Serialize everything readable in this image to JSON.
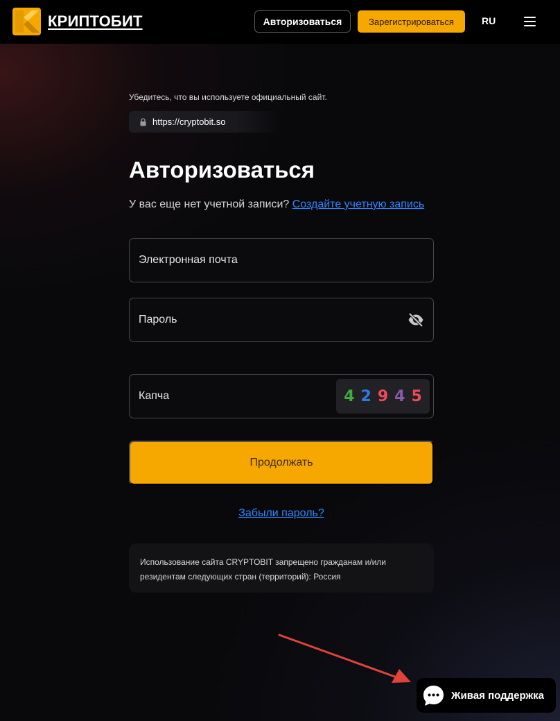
{
  "header": {
    "logo_text": "КРИПТОБИТ",
    "login_label": "Авторизоваться",
    "register_label": "Зарегистрироваться",
    "language": "RU",
    "menu_icon": "hamburger-menu-icon"
  },
  "notice_official": {
    "text": "Убедитесь, что вы используете официальный сайт.",
    "url": "https://cryptobit.so",
    "icon": "lock-icon"
  },
  "form": {
    "title": "Авторизоваться",
    "no_account_text": "У вас еще нет учетной записи?",
    "create_account_link": "Создайте учетную запись",
    "email_placeholder": "Электронная почта",
    "password_placeholder": "Пароль",
    "password_toggle_icon": "eye-off-icon",
    "captcha_placeholder": "Капча",
    "captcha_digits": [
      "4",
      "2",
      "9",
      "4",
      "5"
    ],
    "captcha_colors": [
      "#3fae3a",
      "#2a7de1",
      "#ef4a5a",
      "#8b5aa8",
      "#ef4a5a"
    ],
    "continue_label": "Продолжать",
    "forgot_link": "Забыли пароль?"
  },
  "restriction_notice": "Использование сайта CRYPTOBIT запрещено гражданам и/или резидентам следующих стран (территорий): Россия",
  "support": {
    "label": "Живая поддержка",
    "icon": "chat-bubble-icon"
  },
  "colors": {
    "accent": "#f6a800",
    "link": "#2f86ff",
    "annotation_arrow": "#e0433a"
  }
}
